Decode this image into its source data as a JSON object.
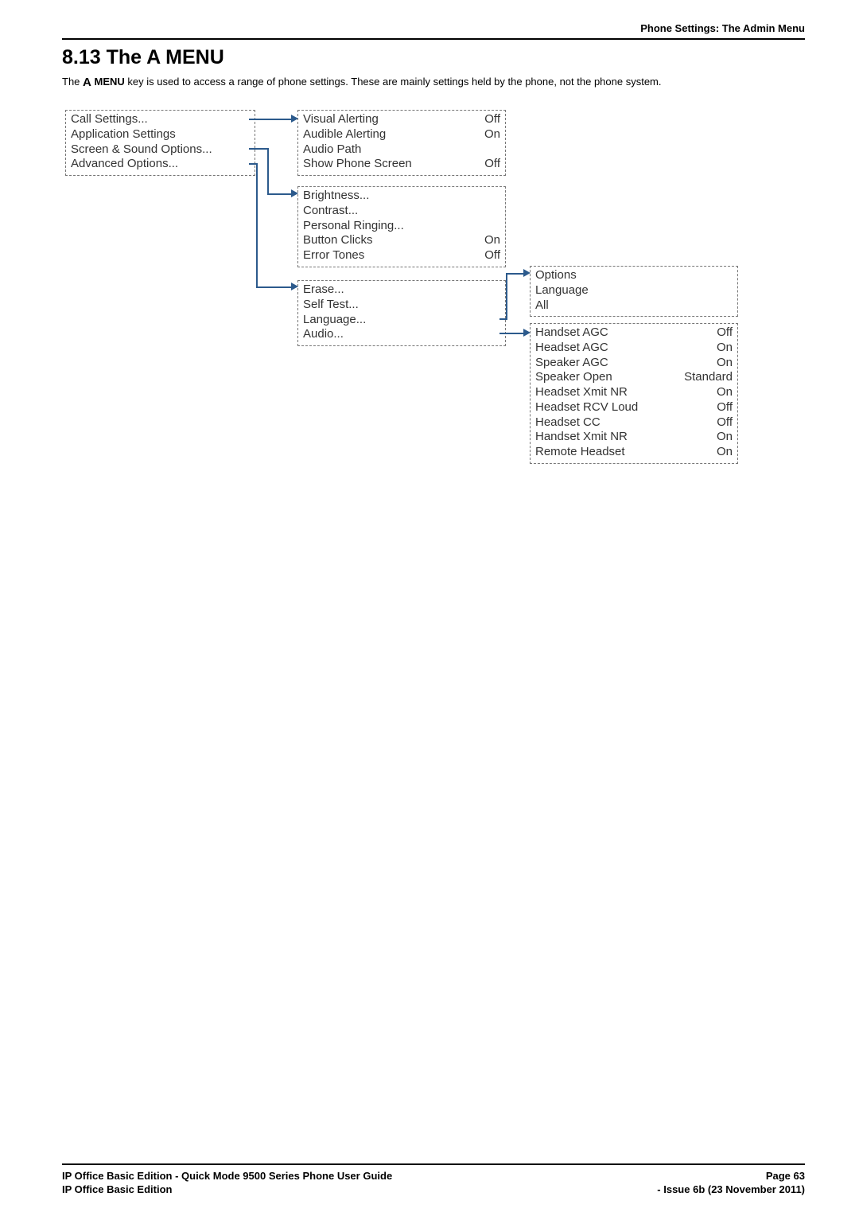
{
  "header_right": "Phone Settings: The Admin Menu",
  "title": "8.13 The A MENU",
  "intro_pre": "The ",
  "intro_key": "MENU",
  "intro_post": " key is used to access a range of phone settings. These are mainly settings held by the phone, not the phone system.",
  "box1": {
    "rows": [
      {
        "label": "Call Settings...",
        "val": ""
      },
      {
        "label": "Application Settings",
        "val": ""
      },
      {
        "label": "Screen & Sound Options...",
        "val": ""
      },
      {
        "label": "Advanced Options...",
        "val": ""
      }
    ]
  },
  "box2": {
    "rows": [
      {
        "label": "Visual Alerting",
        "val": "Off"
      },
      {
        "label": "Audible Alerting",
        "val": "On"
      },
      {
        "label": "Audio Path",
        "val": ""
      },
      {
        "label": "Show Phone Screen",
        "val": "Off"
      }
    ]
  },
  "box3": {
    "rows": [
      {
        "label": "Brightness...",
        "val": ""
      },
      {
        "label": "Contrast...",
        "val": ""
      },
      {
        "label": "Personal Ringing...",
        "val": ""
      },
      {
        "label": "Button Clicks",
        "val": "On"
      },
      {
        "label": "Error Tones",
        "val": "Off"
      }
    ]
  },
  "box4": {
    "rows": [
      {
        "label": "Erase...",
        "val": ""
      },
      {
        "label": "Self Test...",
        "val": ""
      },
      {
        "label": "Language...",
        "val": ""
      },
      {
        "label": "Audio...",
        "val": ""
      }
    ]
  },
  "box5": {
    "rows": [
      {
        "label": "Options",
        "val": ""
      },
      {
        "label": "Language",
        "val": ""
      },
      {
        "label": "All",
        "val": ""
      }
    ]
  },
  "box6": {
    "rows": [
      {
        "label": "Handset AGC",
        "val": "Off"
      },
      {
        "label": "Headset AGC",
        "val": "On"
      },
      {
        "label": "Speaker AGC",
        "val": "On"
      },
      {
        "label": "Speaker Open",
        "val": "Standard"
      },
      {
        "label": "Headset Xmit NR",
        "val": "On"
      },
      {
        "label": "Headset RCV Loud",
        "val": "Off"
      },
      {
        "label": "Headset CC",
        "val": "Off"
      },
      {
        "label": "Handset Xmit NR",
        "val": "On"
      },
      {
        "label": "Remote Headset",
        "val": "On"
      }
    ]
  },
  "footer": {
    "left1": "IP Office Basic Edition - Quick Mode 9500 Series Phone User Guide",
    "left2": "IP Office Basic Edition",
    "right1": "Page 63",
    "right2": "- Issue 6b (23 November 2011)"
  }
}
